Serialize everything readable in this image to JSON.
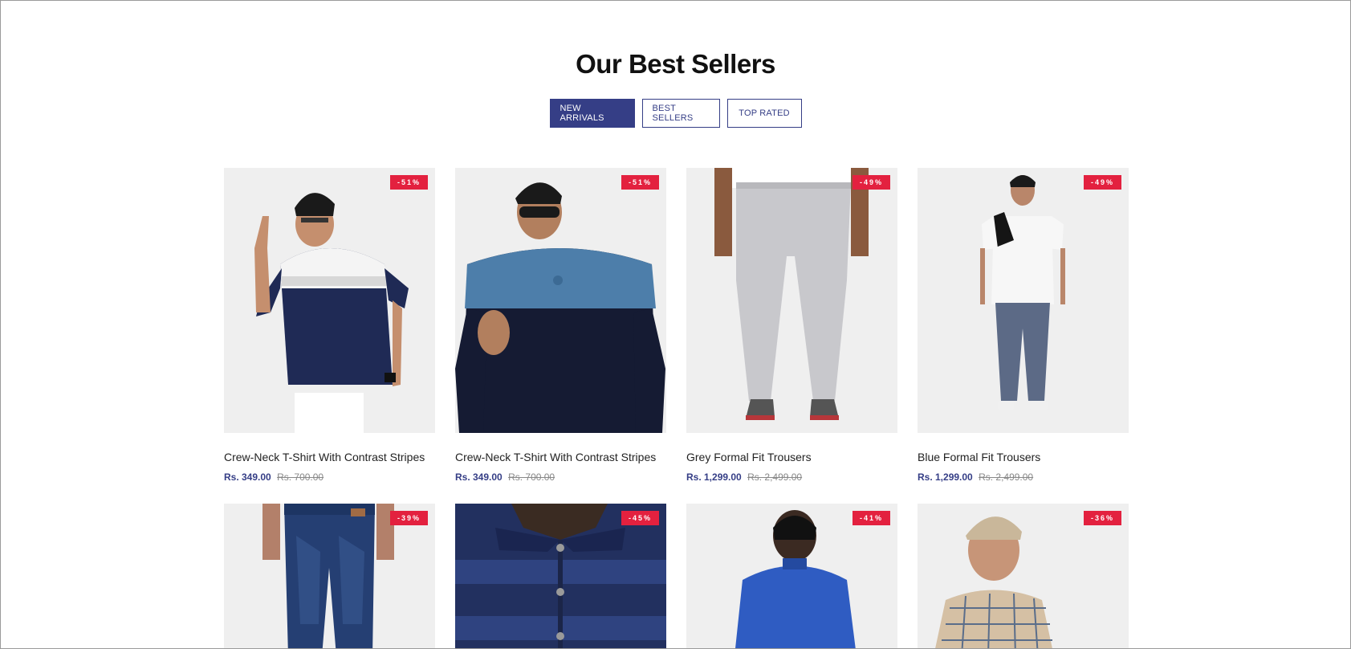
{
  "section": {
    "title": "Our Best Sellers",
    "tabs": [
      {
        "label": "NEW ARRIVALS",
        "active": true
      },
      {
        "label": "BEST SELLERS",
        "active": false
      },
      {
        "label": "TOP RATED",
        "active": false
      }
    ]
  },
  "products": [
    {
      "name": "Crew-Neck T-Shirt With Contrast Stripes",
      "price": "Rs. 349.00",
      "old_price": "Rs. 700.00",
      "discount": "-51%"
    },
    {
      "name": "Crew-Neck T-Shirt With Contrast Stripes",
      "price": "Rs. 349.00",
      "old_price": "Rs. 700.00",
      "discount": "-51%"
    },
    {
      "name": "Grey Formal Fit Trousers",
      "price": "Rs. 1,299.00",
      "old_price": "Rs. 2,499.00",
      "discount": "-49%"
    },
    {
      "name": "Blue Formal Fit Trousers",
      "price": "Rs. 1,299.00",
      "old_price": "Rs. 2,499.00",
      "discount": "-49%"
    },
    {
      "discount": "-39%"
    },
    {
      "discount": "-45%"
    },
    {
      "discount": "-41%"
    },
    {
      "discount": "-36%"
    }
  ],
  "colors": {
    "brand": "#353e86",
    "sale_badge": "#e3213f"
  }
}
